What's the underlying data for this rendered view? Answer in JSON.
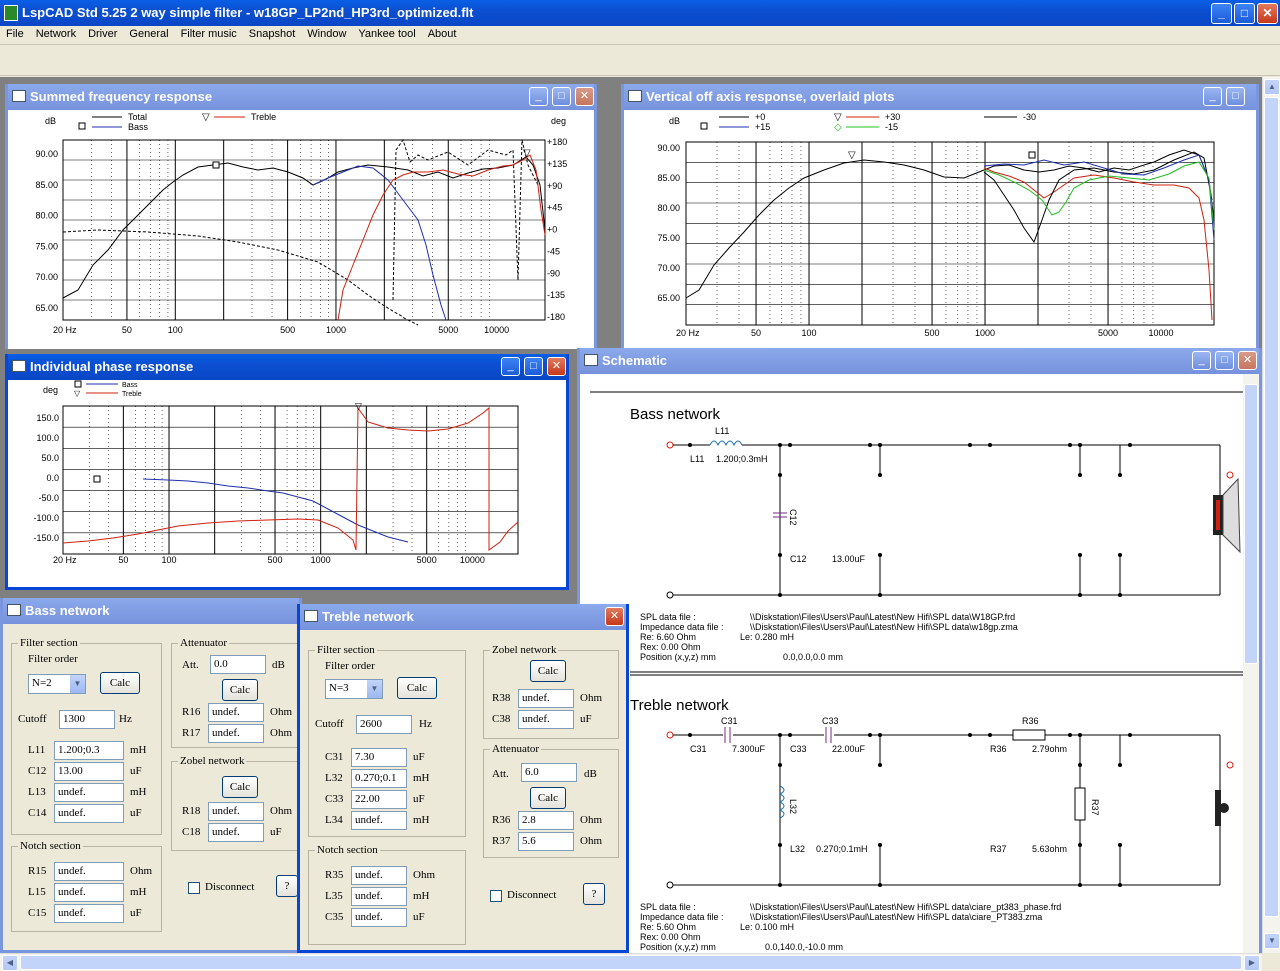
{
  "app": {
    "title": "LspCAD Std 5.25 2 way simple filter - w18GP_LP2nd_HP3rd_optimized.flt",
    "menu": [
      "File",
      "Network",
      "Driver",
      "General",
      "Filter music",
      "Snapshot",
      "Window",
      "Yankee tool",
      "About"
    ]
  },
  "colors": {
    "titlebar": "#0a5fe6",
    "total": "#000000",
    "bass": "#1f2fb0",
    "treble": "#d02010",
    "green": "#20c020"
  },
  "summed": {
    "title": "Summed frequency response",
    "left_unit": "dB",
    "right_unit": "deg",
    "legend": {
      "total": "Total",
      "treble": "Treble",
      "bass": "Bass"
    },
    "y_ticks": [
      "90.00",
      "85.00",
      "80.00",
      "75.00",
      "70.00",
      "65.00"
    ],
    "phase_ticks": [
      "+180",
      "+135",
      "+90",
      "+45",
      "+0",
      "-45",
      "-90",
      "-135",
      "-180"
    ],
    "x_ticks": [
      "20 Hz",
      "50",
      "100",
      "500",
      "1000",
      "5000",
      "10000"
    ]
  },
  "offaxis": {
    "title": "Vertical off axis response, overlaid plots",
    "unit": "dB",
    "legend": [
      "+0",
      "+30",
      "-30",
      "+15",
      "-15"
    ],
    "y_ticks": [
      "90.00",
      "85.00",
      "80.00",
      "75.00",
      "70.00",
      "65.00"
    ],
    "x_ticks": [
      "20 Hz",
      "50",
      "100",
      "500",
      "1000",
      "5000",
      "10000"
    ]
  },
  "phase": {
    "title": "Individual phase response",
    "unit": "deg",
    "legend": {
      "bass": "Bass",
      "treble": "Treble"
    },
    "y_ticks": [
      "150.0",
      "100.0",
      "50.0",
      "0.0",
      "-50.0",
      "-100.0",
      "-150.0"
    ],
    "x_ticks": [
      "20 Hz",
      "50",
      "100",
      "500",
      "1000",
      "5000",
      "10000"
    ]
  },
  "schematic": {
    "title": "Schematic",
    "bass": {
      "heading": "Bass network",
      "L11": "L11",
      "L11_label": "L11",
      "L11_value": "1.200;0.3mH",
      "C12": "C12",
      "C12_label": "C12",
      "C12_value": "13.00uF",
      "spl_label": "SPL data file :",
      "spl_path": "\\\\Diskstation\\Files\\Users\\Paul\\Latest\\New Hifi\\SPL data\\W18GP.frd",
      "imp_label": "Impedance data file :",
      "imp_path": "\\\\Diskstation\\Files\\Users\\Paul\\Latest\\New Hifi\\SPL data\\w18gp.zma",
      "re": "Re:     6.60 Ohm",
      "le": "Le:     0.280 mH",
      "rex": "Rex:    0.00 Ohm",
      "pos_label": "Position (x,y,z) mm",
      "pos_value": "0.0,0.0,0.0 mm"
    },
    "treble": {
      "heading": "Treble network",
      "C31": "C31",
      "C31_label": "C31",
      "C31_value": "7.300uF",
      "C33": "C33",
      "C33_label": "C33",
      "C33_value": "22.00uF",
      "R36": "R36",
      "R36_label": "R36",
      "R36_value": "2.79ohm",
      "L32": "L32",
      "L32_label": "L32",
      "L32_value": "0.270;0.1mH",
      "R37": "R37",
      "R37_label": "R37",
      "R37_value": "5.63ohm",
      "spl_label": "SPL data file :",
      "spl_path": "\\\\Diskstation\\Files\\Users\\Paul\\Latest\\New Hifi\\SPL data\\ciare_pt383_phase.frd",
      "imp_label": "Impedance data file :",
      "imp_path": "\\\\Diskstation\\Files\\Users\\Paul\\Latest\\New Hifi\\SPL data\\ciare_PT383.zma",
      "re": "Re:     5.60 Ohm",
      "le": "Le:     0.100 mH",
      "rex": "Rex:    0.00 Ohm",
      "pos_label": "Position (x,y,z) mm",
      "pos_value": "0.0,140.0,-10.0 mm"
    }
  },
  "bass_net": {
    "title": "Bass network",
    "filter_section": "Filter section",
    "filter_order": "Filter order",
    "order_value": "N=2",
    "calc": "Calc",
    "cutoff_label": "Cutoff",
    "cutoff": "1300",
    "hz": "Hz",
    "rows": [
      {
        "n": "L11",
        "v": "1.200;0.3",
        "u": "mH"
      },
      {
        "n": "C12",
        "v": "13.00",
        "u": "uF"
      },
      {
        "n": "L13",
        "v": "undef.",
        "u": "mH"
      },
      {
        "n": "C14",
        "v": "undef.",
        "u": "uF"
      }
    ],
    "notch_section": "Notch section",
    "notch": [
      {
        "n": "R15",
        "v": "undef.",
        "u": "Ohm"
      },
      {
        "n": "L15",
        "v": "undef.",
        "u": "mH"
      },
      {
        "n": "C15",
        "v": "undef.",
        "u": "uF"
      }
    ],
    "attenuator": "Attenuator",
    "att_label": "Att.",
    "att": "0.0",
    "db": "dB",
    "att_rows": [
      {
        "n": "R16",
        "v": "undef.",
        "u": "Ohm"
      },
      {
        "n": "R17",
        "v": "undef.",
        "u": "Ohm"
      }
    ],
    "zobel": "Zobel network",
    "zobel_rows": [
      {
        "n": "R18",
        "v": "undef.",
        "u": "Ohm"
      },
      {
        "n": "C18",
        "v": "undef.",
        "u": "uF"
      }
    ],
    "disconnect": "Disconnect",
    "help": "?"
  },
  "treble_net": {
    "title": "Treble network",
    "filter_section": "Filter section",
    "filter_order": "Filter order",
    "order_value": "N=3",
    "calc": "Calc",
    "cutoff_label": "Cutoff",
    "cutoff": "2600",
    "hz": "Hz",
    "rows": [
      {
        "n": "C31",
        "v": "7.30",
        "u": "uF"
      },
      {
        "n": "L32",
        "v": "0.270;0.1",
        "u": "mH"
      },
      {
        "n": "C33",
        "v": "22.00",
        "u": "uF"
      },
      {
        "n": "L34",
        "v": "undef.",
        "u": "mH"
      }
    ],
    "notch_section": "Notch section",
    "notch": [
      {
        "n": "R35",
        "v": "undef.",
        "u": "Ohm"
      },
      {
        "n": "L35",
        "v": "undef.",
        "u": "mH"
      },
      {
        "n": "C35",
        "v": "undef.",
        "u": "uF"
      }
    ],
    "zobel": "Zobel network",
    "zobel_rows": [
      {
        "n": "R38",
        "v": "undef.",
        "u": "Ohm"
      },
      {
        "n": "C38",
        "v": "undef.",
        "u": "uF"
      }
    ],
    "attenuator": "Attenuator",
    "att_label": "Att.",
    "att": "6.0",
    "db": "dB",
    "att_rows": [
      {
        "n": "R36",
        "v": "2.8",
        "u": "Ohm"
      },
      {
        "n": "R37",
        "v": "5.6",
        "u": "Ohm"
      }
    ],
    "disconnect": "Disconnect",
    "help": "?"
  }
}
